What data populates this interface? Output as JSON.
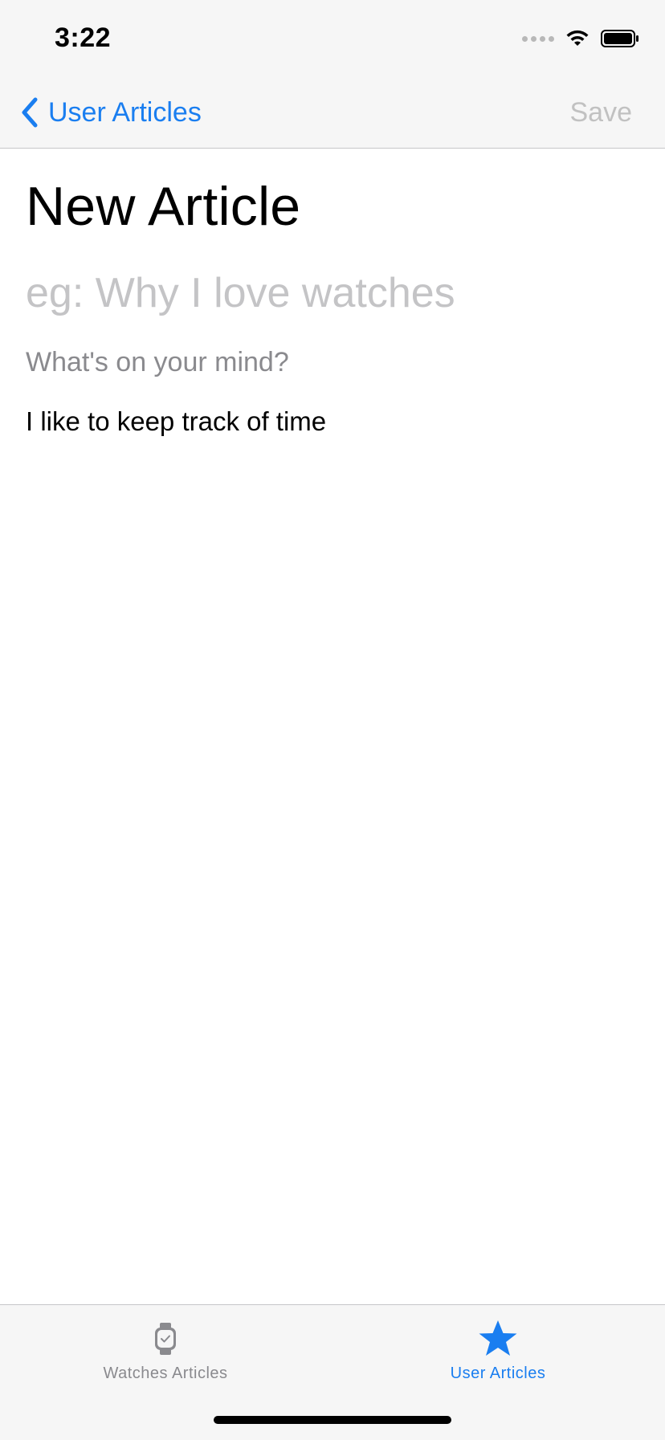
{
  "status_bar": {
    "time": "3:22"
  },
  "nav": {
    "back_label": "User Articles",
    "save_label": "Save"
  },
  "content": {
    "title": "New Article",
    "title_placeholder": "eg: Why I love watches",
    "body_prompt": "What's on your mind?",
    "body_text": "I like to keep track of time"
  },
  "tab_bar": {
    "tabs": [
      {
        "label": "Watches Articles",
        "icon": "watch-icon",
        "active": false
      },
      {
        "label": "User Articles",
        "icon": "star-icon",
        "active": true
      }
    ]
  },
  "colors": {
    "accent": "#1a7ef0",
    "disabled": "#c1c1c1",
    "placeholder": "#c4c4c6",
    "inactive_tab": "#8a8a8e",
    "bar_background": "#f6f6f6"
  }
}
